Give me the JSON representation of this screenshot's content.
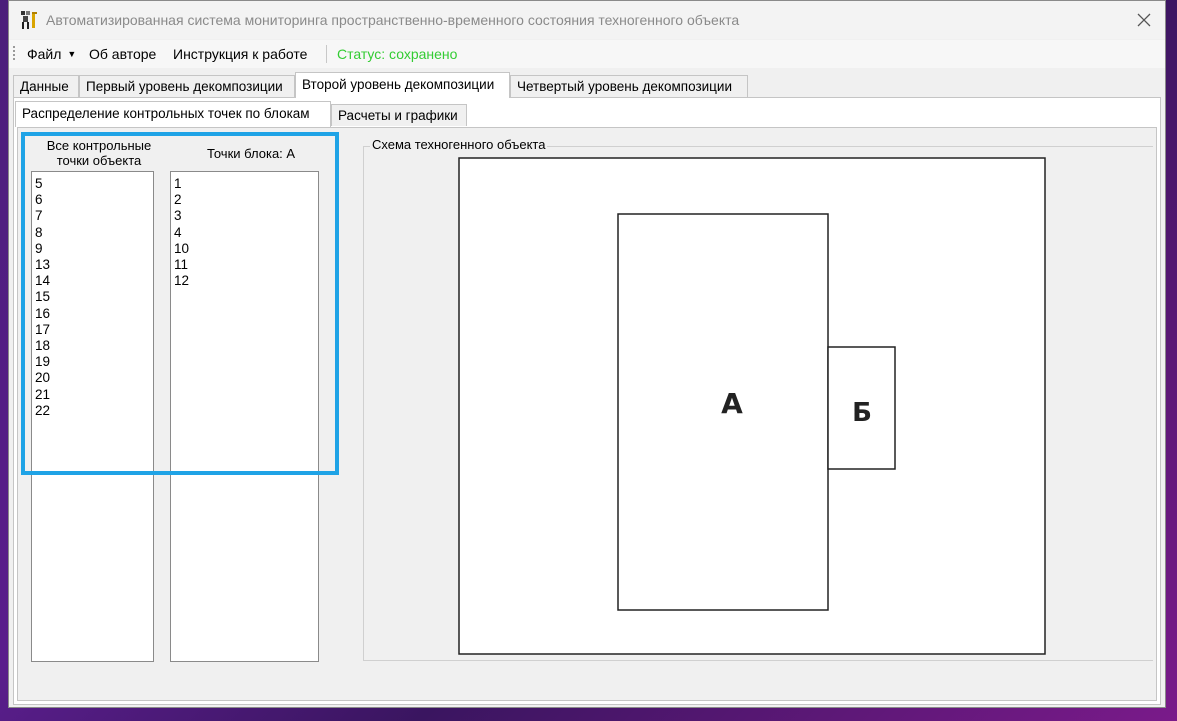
{
  "window": {
    "title": "Автоматизированная система мониторинга пространственно-временного состояния техногенного объекта"
  },
  "menu": {
    "file": "Файл",
    "about": "Об авторе",
    "manual": "Инструкция к работе",
    "status": "Статус: сохранено"
  },
  "tabs_main": [
    {
      "label": "Данные"
    },
    {
      "label": "Первый уровень декомпозиции"
    },
    {
      "label": "Второй уровень декомпозиции"
    },
    {
      "label": "Четвертый уровень декомпозиции"
    }
  ],
  "tabs_sub": [
    {
      "label": "Распределение контрольных точек по блокам"
    },
    {
      "label": "Расчеты и графики"
    }
  ],
  "all_points": {
    "header": "Все контрольные точки объекта",
    "items": [
      "5",
      "6",
      "7",
      "8",
      "9",
      "13",
      "14",
      "15",
      "16",
      "17",
      "18",
      "19",
      "20",
      "21",
      "22"
    ]
  },
  "block_points": {
    "header": "Точки блока: А",
    "items": [
      "1",
      "2",
      "3",
      "4",
      "10",
      "11",
      "12"
    ]
  },
  "scheme": {
    "title": "Схема техногенного объекта",
    "block_a": "А",
    "block_b": "Б"
  },
  "colors": {
    "status": "#33cc33",
    "highlight": "#1fa3e6"
  }
}
